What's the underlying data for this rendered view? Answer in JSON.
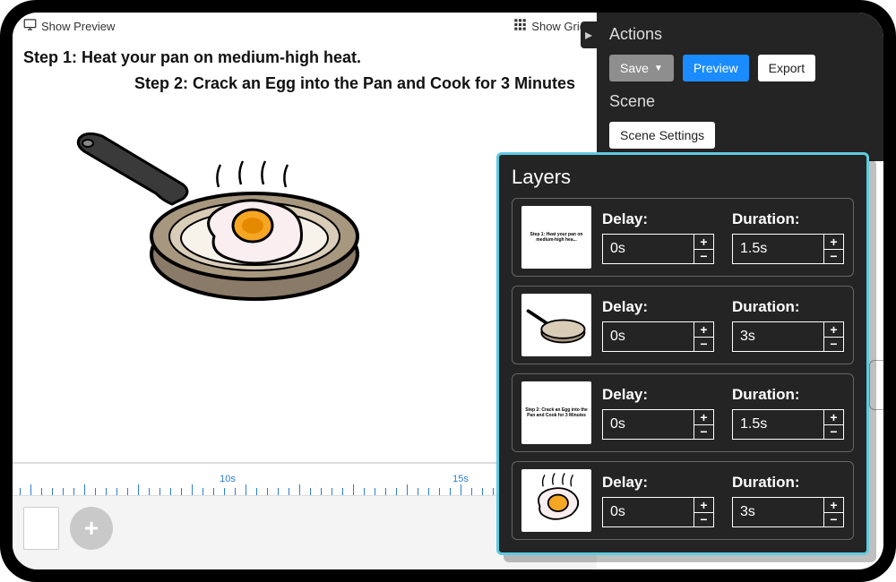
{
  "topbar": {
    "show_preview": "Show Preview",
    "show_grid": "Show Grid"
  },
  "steps": {
    "step1": "Step 1: Heat your pan on medium-high heat.",
    "step2": "Step 2: Crack an Egg into the Pan and Cook for 3 Minutes"
  },
  "timeline": {
    "label_10s": "10s",
    "label_15s": "15s"
  },
  "right": {
    "actions_heading": "Actions",
    "save_label": "Save",
    "preview_label": "Preview",
    "export_label": "Export",
    "scene_heading": "Scene",
    "scene_settings_label": "Scene Settings"
  },
  "layers": {
    "title": "Layers",
    "delay_label": "Delay:",
    "duration_label": "Duration:",
    "items": [
      {
        "delay": "0s",
        "duration": "1.5s",
        "thumb_type": "text1"
      },
      {
        "delay": "0s",
        "duration": "3s",
        "thumb_type": "pan"
      },
      {
        "delay": "0s",
        "duration": "1.5s",
        "thumb_type": "text2"
      },
      {
        "delay": "0s",
        "duration": "3s",
        "thumb_type": "egg"
      }
    ]
  }
}
